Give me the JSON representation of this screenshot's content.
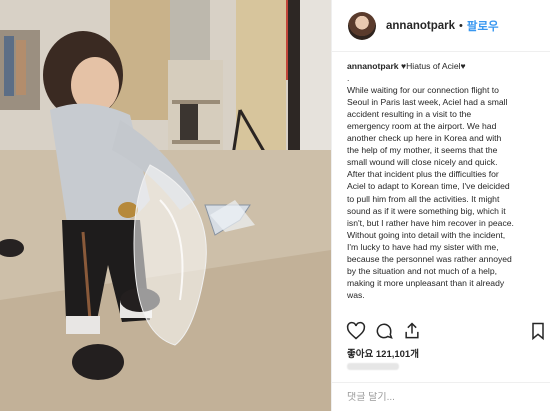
{
  "post": {
    "username": "annanotpark",
    "follow_label": "팔로우",
    "separator": "•",
    "caption_lines": [
      "Hiatus of Aciel",
      ".",
      "While waiting for our connection flight to",
      "Seoul in Paris last week, Aciel had a small",
      "accident resulting in a visit to the",
      "emergency room at the airport. We had",
      "another check up here in Korea and with",
      "the help of my mother, it seems that the",
      "small wound will close nicely and quick.",
      "After that incident plus the difficulties for",
      "Aciel to adapt to Korean time, I've deicided",
      "to pull him from all the activities. It might",
      "sound as if it were something big, which it",
      "isn't, but I rather have him recover in peace.",
      "Without going into detail with the incident,",
      "I'm lucky to have had my sister with me,",
      "because the personnel was rather annoyed",
      "by the situation and not much of a help,",
      "making it more unpleasant than it already",
      "was."
    ],
    "likes_prefix": "좋아요",
    "likes_count": "121,101개",
    "comment_placeholder": "댓글 달기..."
  },
  "icons": {
    "like": "heart-icon",
    "comment": "comment-icon",
    "share": "share-icon",
    "save": "bookmark-icon",
    "hiatus_emoji": "black-heart-icon"
  },
  "colors": {
    "follow": "#3897f0",
    "text": "#262626",
    "border": "#efefef"
  }
}
